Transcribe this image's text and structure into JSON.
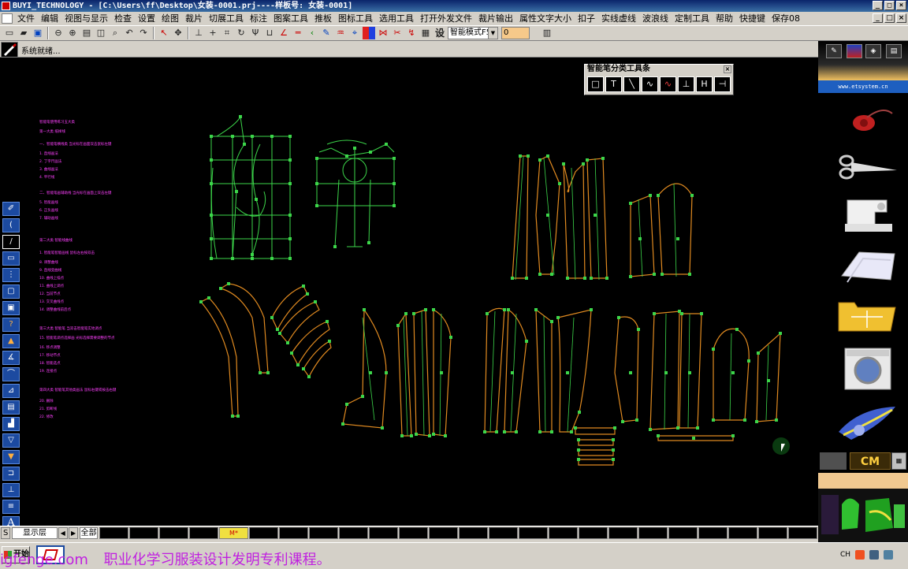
{
  "window": {
    "title": "BUYI_TECHNOLOGY - [C:\\Users\\ff\\Desktop\\女装-0001.prj----样板号: 女装-0001]",
    "min_label": "_",
    "max_label": "□",
    "close_label": "×"
  },
  "menu": [
    "文件",
    "编辑",
    "视图与显示",
    "检查",
    "设置",
    "绘图",
    "裁片",
    "切展工具",
    "标注",
    "图案工具",
    "推板",
    "图标工具",
    "选用工具",
    "打开外发文件",
    "裁片输出",
    "属性文字大小",
    "扣子",
    "实线虚线",
    "波浪线",
    "定制工具",
    "帮助",
    "快捷键",
    "保存08"
  ],
  "toolbar": {
    "mode_select": "智能模式F5",
    "value_field": "0",
    "set_label": "设"
  },
  "status": {
    "text": "系统就绪..."
  },
  "palette": {
    "title": "智能笔分类工具条",
    "close": "×",
    "tools": [
      "rect-tool-icon",
      "t-square-icon",
      "diagonal-line-icon",
      "wave-icon",
      "curve-tool-icon",
      "hline-icon",
      "h-tool-icon",
      "dash-icon"
    ]
  },
  "notes": [
    "智能笔使用练习五大类",
    "第一大类  纸样线",
    "一、智能笔横线类    当光标在画面双击鼠标左键",
    "1. 直线画法",
    "2. 丁字尺画法",
    "3. 曲线画法",
    "4. 平行线",
    "二、智能笔画辅助线    当光标在画面上双击左键",
    "5. 智能画线",
    "6. 正负画线",
    "7. 辅助画线",
    "第二大类  智能线曲线",
    "1. 智能笔智能画线    鼠标左右按双击",
    "8. 调整曲线",
    "9. 直线变曲线",
    "10. 曲线上描点",
    "11. 曲线上调点",
    "12. 当前节点",
    "13. 交叉曲线点",
    "14. 调整曲线前后点",
    "第三大类  智能笔  当双击智能笔实地调点",
    "15. 智能笔调点选择画    光标选择需要调整的节点",
    "16. 移点调整",
    "17. 移动节点",
    "18. 智能选点",
    "19. 连接点",
    "第四大类  智能笔其他类画法    鼠标右键或按击右键",
    "20. 删除",
    "21. 剪断线",
    "22. 修改"
  ],
  "right_panel": {
    "url": "www.etsystem.cn",
    "unit": "CM",
    "tools": [
      "thread-button-icon",
      "scissors-icon",
      "sewing-machine-icon",
      "fabric-icon",
      "pattern-folder-icon",
      "washing-machine-icon",
      "measuring-tape-icon"
    ]
  },
  "layers": {
    "s_label": "S",
    "layer_name": "显示层",
    "all_label": "全部",
    "active_slot": "M*"
  },
  "taskbar": {
    "start_label": "开始",
    "overlay_site": "igfenge.com",
    "overlay_text": "职业化学习服装设计发明专利课程。",
    "tray_lang": "CH"
  },
  "colors": {
    "canvas": "#000000",
    "pattern_green": "#3cd64a",
    "pattern_orange": "#e08a20",
    "notes": "#ff40ff"
  }
}
